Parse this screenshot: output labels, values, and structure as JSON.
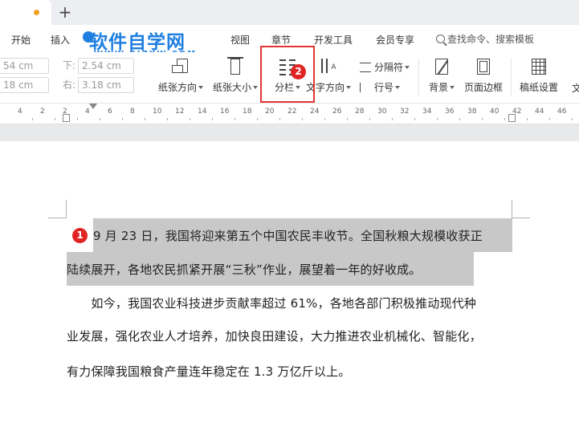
{
  "tabs": {
    "new_tab_label": "+"
  },
  "watermark": {
    "title": "软件自学网",
    "subtitle": "WWW.RJZXW.COM"
  },
  "menu": {
    "items": [
      "开始",
      "插入",
      "视图",
      "章节",
      "开发工具",
      "会员专享"
    ],
    "search_placeholder": "查找命令、搜索模板"
  },
  "margins": {
    "top_value": "54 cm",
    "bottom_label": "下:",
    "bottom_value": "2.54 cm",
    "left_value": "18 cm",
    "right_label": "右:",
    "right_value": "3.18 cm"
  },
  "ribbon": {
    "orientation": "纸张方向",
    "size": "纸张大小",
    "columns": "分栏",
    "text_direction": "文字方向",
    "separator": "分隔符",
    "line_number": "行号",
    "background": "背景",
    "page_border": "页面边框",
    "grid_paper": "稿纸设置",
    "cut_off": "文"
  },
  "badges": {
    "step1": "1",
    "step2": "2"
  },
  "ruler": {
    "labels": [
      "4",
      "2",
      "2",
      "4",
      "6",
      "8",
      "10",
      "12",
      "14",
      "16",
      "18",
      "20",
      "22",
      "24",
      "26",
      "28",
      "30",
      "32",
      "34",
      "36",
      "38",
      "40",
      "42",
      "44",
      "46"
    ]
  },
  "document": {
    "lines": [
      "9 月 23 日，我国将迎来第五个中国农民丰收节。全国秋粮大规模收获正",
      "陆续展开，各地农民抓紧开展“三秋”作业，展望着一年的好收成。",
      "　　如今，我国农业科技进步贡献率超过 61%，各地各部门积极推动现代种",
      "业发展，强化农业人才培养，加快良田建设，大力推进农业机械化、智能化，",
      "有力保障我国粮食产量连年稳定在 1.3 万亿斤以上。"
    ]
  },
  "colors": {
    "accent_red": "#e53535",
    "watermark_blue": "#1f7fe0",
    "selection": "#c8c8c8"
  }
}
